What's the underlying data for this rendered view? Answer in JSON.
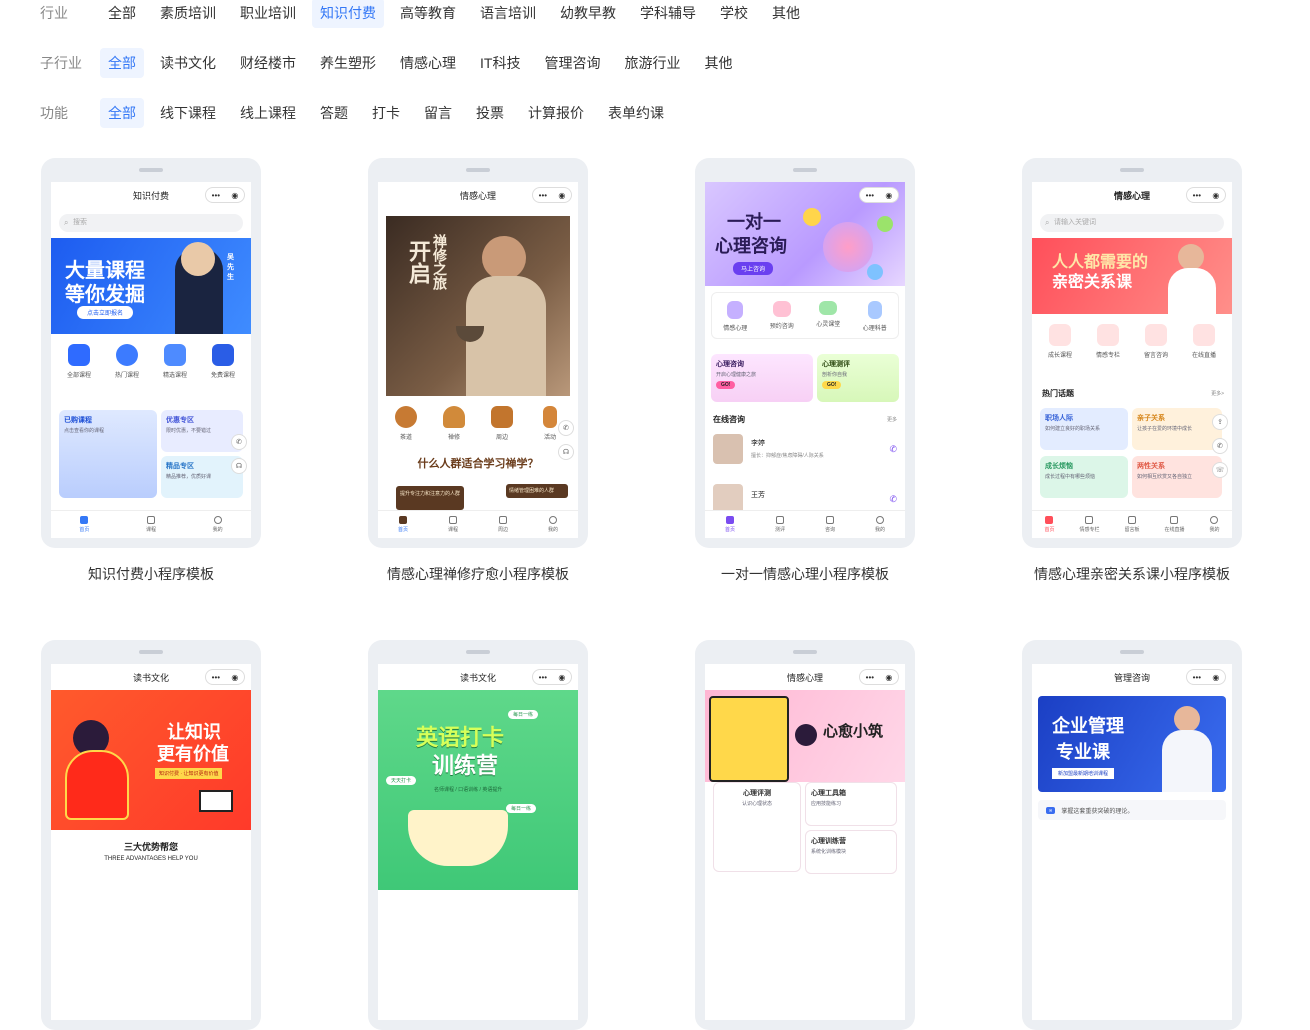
{
  "filters": [
    {
      "label": "行业",
      "options": [
        "全部",
        "素质培训",
        "职业培训",
        "知识付费",
        "高等教育",
        "语言培训",
        "幼教早教",
        "学科辅导",
        "学校",
        "其他"
      ],
      "active": 3
    },
    {
      "label": "子行业",
      "options": [
        "全部",
        "读书文化",
        "财经楼市",
        "养生塑形",
        "情感心理",
        "IT科技",
        "管理咨询",
        "旅游行业",
        "其他"
      ],
      "active": 0
    },
    {
      "label": "功能",
      "options": [
        "全部",
        "线下课程",
        "线上课程",
        "答题",
        "打卡",
        "留言",
        "投票",
        "计算报价",
        "表单约课"
      ],
      "active": 0
    }
  ],
  "capsule": {
    "dots": "•••",
    "target": "◉"
  },
  "templates": [
    {
      "title": "知识付费小程序模板",
      "screen_title": "知识付费",
      "search_placeholder": "搜索",
      "banner_line1": "大量课程",
      "banner_line2": "等你发掘",
      "banner_button": "点击立即报名",
      "banner_tag": "吴先生",
      "icons": [
        "全部课程",
        "热门课程",
        "精选课程",
        "免费课程"
      ],
      "boxes": [
        {
          "title": "已购课程",
          "sub": "点击查看你的课程"
        },
        {
          "title": "优惠专区",
          "sub": "限时优惠，不要错过"
        },
        {
          "title": "精品专区",
          "sub": "精品推荐，优质好课"
        }
      ],
      "tabs": [
        "首页",
        "课程",
        "我的"
      ]
    },
    {
      "title": "情感心理禅修疗愈小程序模板",
      "screen_title": "情感心理",
      "banner_line1": "开启",
      "banner_line2": "禅修之旅",
      "icons": [
        "茶道",
        "禅修",
        "周边",
        "活动"
      ],
      "heading": "什么人群适合学习禅学？",
      "chips": [
        "提升专注力和注意力的人群",
        "情绪管理困难的人群"
      ],
      "tabs": [
        "首页",
        "课程",
        "周边",
        "我的"
      ]
    },
    {
      "title": "一对一情感心理小程序模板",
      "banner_line1": "一对一",
      "banner_line2": "心理咨询",
      "banner_button": "马上咨询",
      "icons": [
        "情感心理",
        "预约咨询",
        "心灵课堂",
        "心理科普"
      ],
      "boxes": [
        {
          "title": "心理咨询",
          "sub": "开启心理健康之旅",
          "go": "GO!"
        },
        {
          "title": "心理测评",
          "sub": "剖析你自我",
          "go": "GO!"
        }
      ],
      "section": "在线咨询",
      "more": "更多",
      "people": [
        {
          "name": "李婷",
          "desc": "擅长：抑郁症/焦虑障碍/人际关系"
        },
        {
          "name": "王芳",
          "desc": ""
        }
      ],
      "tabs": [
        "首页",
        "测评",
        "咨询",
        "我的"
      ]
    },
    {
      "title": "情感心理亲密关系课小程序模板",
      "screen_title": "情感心理",
      "search_placeholder": "请输入关键词",
      "banner_line1": "人人都需要的",
      "banner_line2": "亲密关系课",
      "icons": [
        "成长课程",
        "情感专栏",
        "留言咨询",
        "在线直播"
      ],
      "section": "热门话题",
      "more": "更多>",
      "boxes": [
        {
          "title": "职场人际",
          "sub": "如何建立良好的职场关系"
        },
        {
          "title": "亲子关系",
          "sub": "让孩子在爱的环境中成长"
        },
        {
          "title": "成长烦恼",
          "sub": "成长过程中有哪些烦恼"
        },
        {
          "title": "两性关系",
          "sub": "如何相互欣赏又各自独立"
        }
      ],
      "tabs": [
        "首页",
        "情感专栏",
        "留言板",
        "在线直播",
        "我的"
      ]
    },
    {
      "screen_title": "读书文化",
      "banner_line1": "让知识",
      "banner_line2": "更有价值",
      "banner_sub": "知识付费 · 让知识更有价值",
      "caption1": "三大优势帮您",
      "caption2": "THREE ADVANTAGES HELP YOU"
    },
    {
      "screen_title": "读书文化",
      "banner_line1": "英语打卡",
      "banner_line2": "训练营",
      "banner_sub": "名师课程 / 口语训练 / 英语提升",
      "tag1": "天天打卡",
      "tag2": "每日一练",
      "tag3": "每日一练"
    },
    {
      "screen_title": "情感心理",
      "banner_line1": "心愈小筑",
      "boxes": [
        {
          "title": "心理评测",
          "sub": "认识心理状态"
        },
        {
          "title": "心理工具箱",
          "sub": "应用技能练习"
        },
        {
          "title": "心理训练营",
          "sub": "系统化训练模块"
        }
      ]
    },
    {
      "screen_title": "管理咨询",
      "banner_line1": "企业管理",
      "banner_line2": "专业课",
      "banner_button": "新加盟最新期培训课程",
      "notice": "掌握这套重获突破的理论。"
    }
  ]
}
